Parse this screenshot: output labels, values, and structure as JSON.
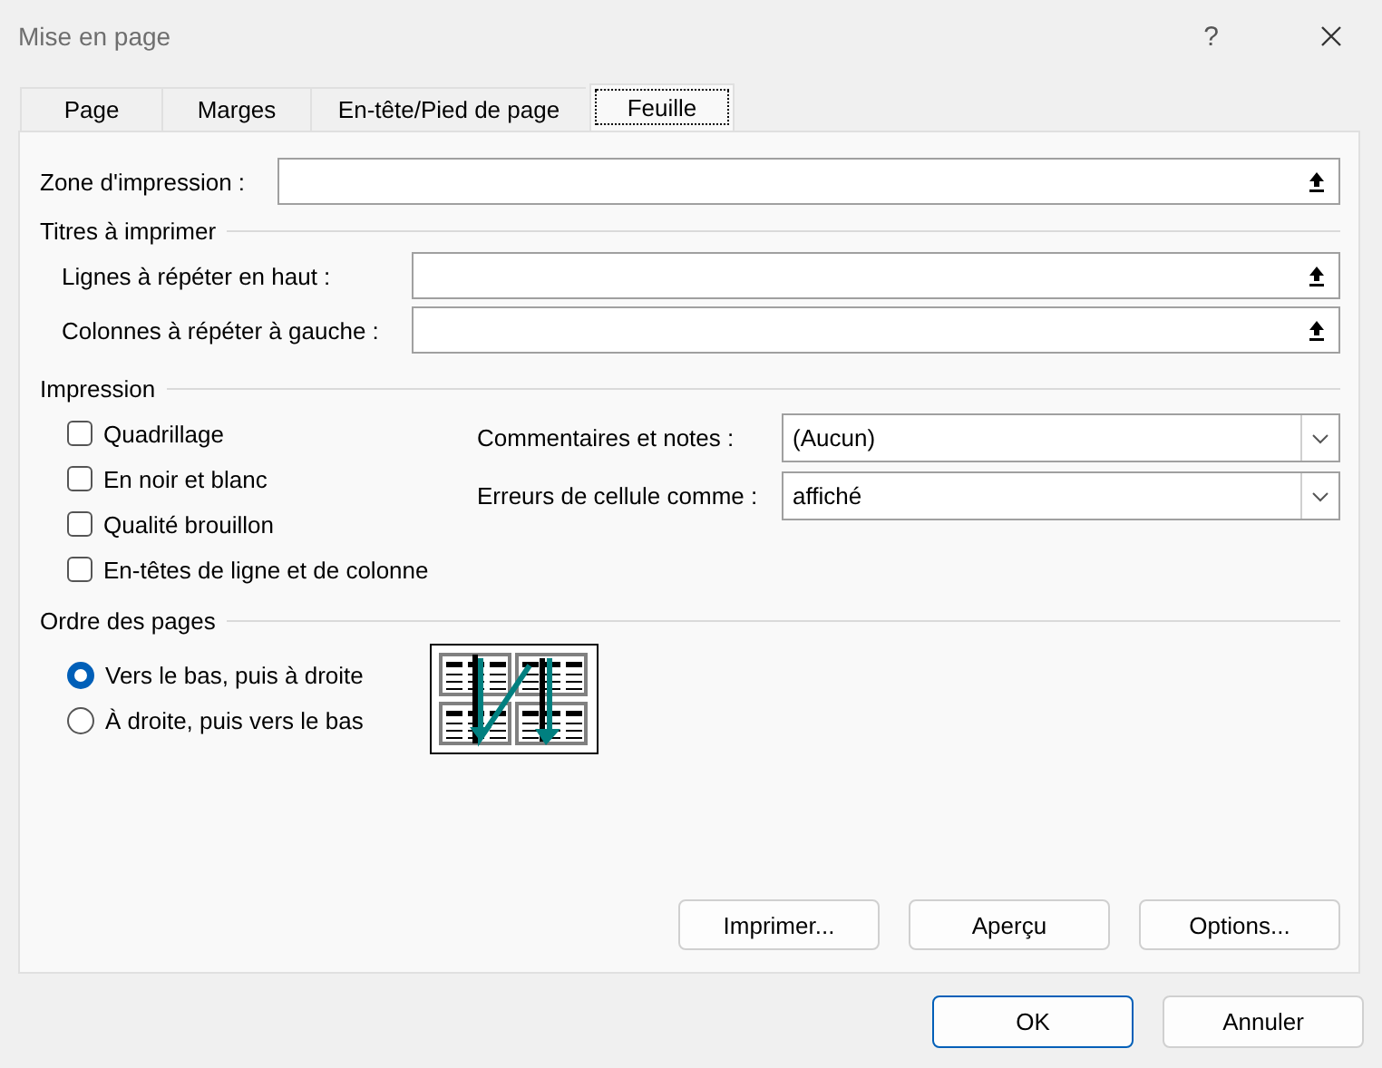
{
  "window": {
    "title": "Mise en page",
    "help": "?"
  },
  "tabs": [
    {
      "label": "Page",
      "selected": false
    },
    {
      "label": "Marges",
      "selected": false
    },
    {
      "label": "En-tête/Pied de page",
      "selected": false
    },
    {
      "label": "Feuille",
      "selected": true
    }
  ],
  "print_area": {
    "label": "Zone d'impression :"
  },
  "print_titles": {
    "heading": "Titres à imprimer",
    "fields": [
      {
        "label": "Lignes à répéter en haut :"
      },
      {
        "label": "Colonnes à répéter à gauche :"
      }
    ]
  },
  "print": {
    "heading": "Impression",
    "checkboxes": [
      {
        "label": "Quadrillage",
        "checked": false
      },
      {
        "label": "En noir et blanc",
        "checked": false
      },
      {
        "label": "Qualité brouillon",
        "checked": false
      },
      {
        "label": "En-têtes de ligne et de colonne",
        "checked": false
      }
    ],
    "dropdowns": [
      {
        "label": "Commentaires et notes :",
        "value": "(Aucun)"
      },
      {
        "label": "Erreurs de cellule comme :",
        "value": "affiché"
      }
    ]
  },
  "page_order": {
    "heading": "Ordre des pages",
    "options": [
      {
        "label": "Vers le bas, puis à droite",
        "selected": true
      },
      {
        "label": "À droite, puis vers le bas",
        "selected": false
      }
    ]
  },
  "buttons": [
    "Imprimer...",
    "Aperçu",
    "Options..."
  ],
  "dialog_buttons": [
    {
      "label": "OK",
      "default": true
    },
    {
      "label": "Annuler",
      "default": false
    }
  ]
}
